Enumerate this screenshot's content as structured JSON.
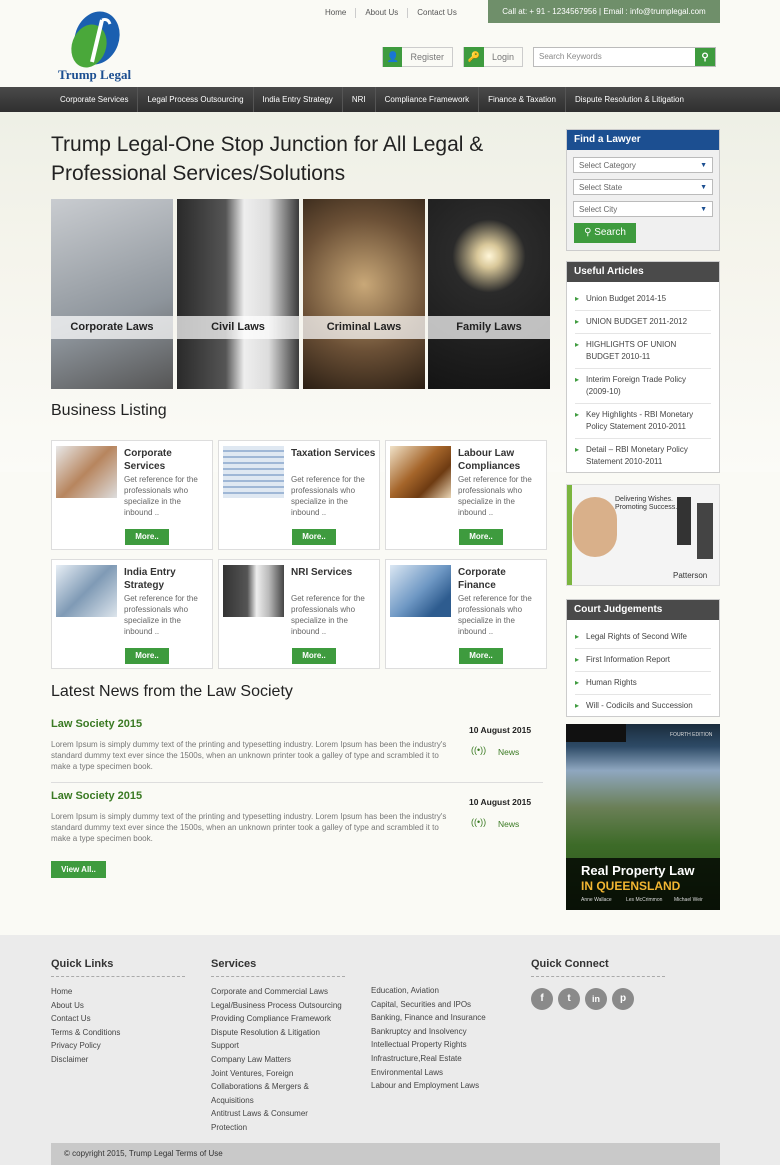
{
  "brand": {
    "name": "Trump Legal"
  },
  "top_links": [
    "Home",
    "About Us",
    "Contact Us"
  ],
  "call_bar": "Call at: + 91 - 1234567956 | Email : info@trumplegal.com",
  "auth": {
    "register": "Register",
    "login": "Login"
  },
  "search": {
    "placeholder": "Search Keywords"
  },
  "nav": [
    "Corporate Services",
    "Legal Process Outsourcing",
    "India Entry Strategy",
    "NRI",
    "Compliance Framework",
    "Finance & Taxation",
    "Dispute Resolution & Litigation"
  ],
  "hero": {
    "title": "Trump Legal-One Stop Junction for All Legal & Professional Services/Solutions"
  },
  "tiles": [
    "Corporate Laws",
    "Civil Laws",
    "Criminal Laws",
    "Family Laws"
  ],
  "business": {
    "heading": "Business Listing",
    "cards": [
      {
        "title": "Corporate Services",
        "desc": "Get reference for the professionals who specialize in the inbound ..",
        "more": "More.."
      },
      {
        "title": "Taxation Services",
        "desc": "Get reference for the professionals who specialize in the inbound ..",
        "more": "More.."
      },
      {
        "title": "Labour Law Compliances",
        "desc": "Get reference for the professionals who specialize in the inbound ..",
        "more": "More.."
      },
      {
        "title": "India Entry Strategy",
        "desc": "Get reference for the professionals who specialize in the inbound ..",
        "more": "More.."
      },
      {
        "title": "NRI Services",
        "desc": "Get reference for the professionals who specialize in the inbound ..",
        "more": "More.."
      },
      {
        "title": "Corporate Finance",
        "desc": "Get reference for the professionals who specialize in the inbound ..",
        "more": "More.."
      }
    ]
  },
  "news": {
    "heading": "Latest News from the Law Society",
    "items": [
      {
        "title": "Law Society 2015",
        "text": "Lorem Ipsum is simply dummy text of the printing and typesetting industry. Lorem Ipsum has been the industry's standard dummy text ever since the 1500s, when an unknown printer took a galley of type and scrambled it to make a type specimen book.",
        "date": "10 August 2015",
        "tag": "News"
      },
      {
        "title": "Law Society 2015",
        "text": "Lorem Ipsum is simply dummy text of the printing and typesetting industry. Lorem Ipsum has been the industry's standard dummy text ever since the 1500s, when an unknown printer took a galley of type and scrambled it to make a type specimen book.",
        "date": "10 August 2015",
        "tag": "News"
      }
    ],
    "view_all": "View All.."
  },
  "find_lawyer": {
    "heading": "Find a Lawyer",
    "category": "Select Category",
    "state": "Select State",
    "city": "Select City",
    "search": "Search"
  },
  "useful_articles": {
    "heading": "Useful Articles",
    "items": [
      "Union Budget 2014-15",
      "UNION BUDGET 2011-2012",
      "HIGHLIGHTS OF UNION BUDGET 2010-11",
      "Interim Foreign Trade Policy (2009-10)",
      "Key Highlights - RBI Monetary Policy Statement 2010-2011",
      "Detail – RBI Monetary Policy Statement 2010-2011"
    ]
  },
  "ad1": {
    "line1": "Delivering Wishes.",
    "line2": "Promoting Success.",
    "brand": "Patterson"
  },
  "court": {
    "heading": "Court Judgements",
    "items": [
      "Legal Rights of Second Wife",
      "First Information Report",
      "Human Rights",
      "Will - Codicils and Succession"
    ]
  },
  "book": {
    "edition": "FOURTH EDITION",
    "title1": "Real Property Law",
    "title2": "IN QUEENSLAND",
    "authors": [
      "Anne Wallace",
      "Les McCrimmon",
      "Michael Weir"
    ]
  },
  "footer": {
    "quick_links_heading": "Quick Links",
    "quick_links": [
      "Home",
      "About Us",
      "Contact Us",
      "Terms & Conditions",
      "Privacy Policy",
      "Disclaimer"
    ],
    "services_heading": "Services",
    "services_col1": [
      "Corporate and Commercial Laws",
      "Legal/Business Process Outsourcing",
      "Providing Compliance Framework",
      "Dispute Resolution & Litigation",
      "Support",
      "Company Law Matters",
      "Joint Ventures, Foreign",
      "Collaborations & Mergers &",
      "Acquisitions",
      "Antitrust Laws & Consumer",
      "Protection"
    ],
    "services_col2": [
      "Education, Aviation",
      "Capital, Securities and IPOs",
      "Banking, Finance and Insurance",
      "Bankruptcy and Insolvency",
      "Intellectual Property Rights",
      "Infrastructure,Real Estate",
      "Environmental Laws",
      "Labour and Employment Laws"
    ],
    "connect_heading": "Quick Connect",
    "social": [
      "f",
      "t",
      "in",
      "p"
    ],
    "copyright": "© copyright 2015, Trump Legal Terms of Use"
  }
}
